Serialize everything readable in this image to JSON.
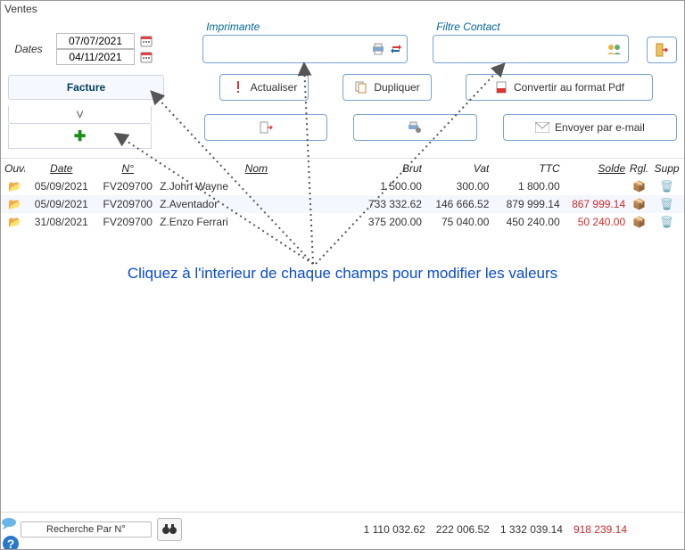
{
  "window_title": "Ventes",
  "dates": {
    "label": "Dates",
    "from": "07/07/2021",
    "to": "04/11/2021"
  },
  "printer": {
    "label": "Imprimante"
  },
  "filter": {
    "label": "Filtre  Contact"
  },
  "left": {
    "facture": "Facture",
    "v": "V"
  },
  "buttons": {
    "actualiser": "Actualiser",
    "dupliquer": "Dupliquer",
    "pdf": "Convertir au format Pdf",
    "email": "Envoyer par e-mail"
  },
  "headers": {
    "ouvrir": "Ouvrir",
    "date": "Date",
    "no": "N°",
    "nom": "Nom",
    "brut": "Brut",
    "vat": "Vat",
    "ttc": "TTC",
    "solde": "Solde",
    "rgl": "Rgl.",
    "supp": "Supp"
  },
  "rows": [
    {
      "date": "05/09/2021",
      "no": "FV209700",
      "nom": "Z.John Wayne",
      "brut": "1 500.00",
      "vat": "300.00",
      "ttc": "1 800.00",
      "solde": ""
    },
    {
      "date": "05/09/2021",
      "no": "FV209700",
      "nom": "Z.Aventador",
      "brut": "733 332.62",
      "vat": "146 666.52",
      "ttc": "879 999.14",
      "solde": "867 999.14"
    },
    {
      "date": "31/08/2021",
      "no": "FV209700",
      "nom": "Z.Enzo Ferrari",
      "brut": "375 200.00",
      "vat": "75 040.00",
      "ttc": "450 240.00",
      "solde": "50 240.00"
    }
  ],
  "callout": "Cliquez à l'interieur de chaque champs pour modifier les valeurs",
  "footer": {
    "search_label": "Recherche Par N°",
    "totals": {
      "brut": "1 110 032.62",
      "vat": "222 006.52",
      "ttc": "1 332 039.14",
      "solde": "918 239.14"
    }
  }
}
